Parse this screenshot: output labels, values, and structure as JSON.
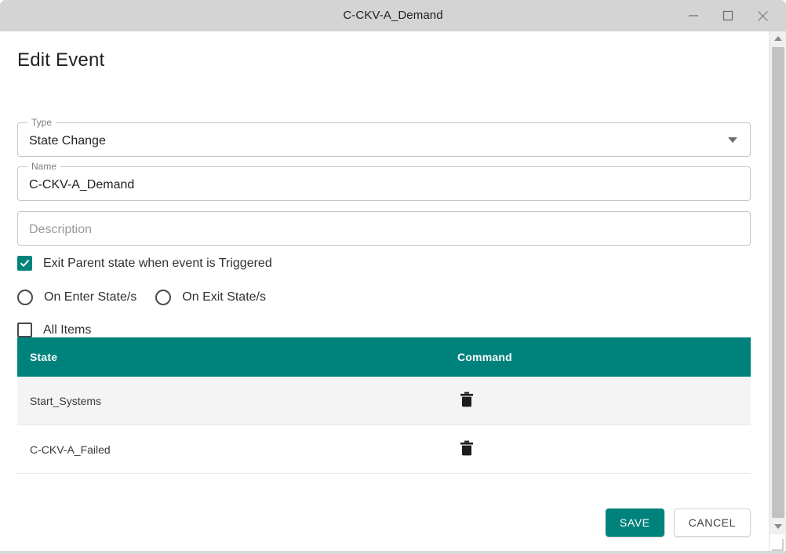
{
  "window": {
    "title": "C-CKV-A_Demand",
    "controls": {
      "minimize": "minimize-icon",
      "maximize": "maximize-icon",
      "close": "close-icon"
    }
  },
  "dialog": {
    "heading": "Edit Event",
    "fields": {
      "type": {
        "label": "Type",
        "value": "State Change",
        "icon": "chevron-down-icon"
      },
      "name": {
        "label": "Name",
        "value": "C-CKV-A_Demand"
      },
      "description": {
        "label": "",
        "value": "",
        "placeholder": "Description"
      }
    },
    "options": {
      "exit_parent": {
        "label": "Exit Parent state when event is Triggered",
        "checked": true
      },
      "on_enter": {
        "label": "On Enter State/s",
        "selected": false
      },
      "on_exit": {
        "label": "On Exit State/s",
        "selected": false
      },
      "all_items": {
        "label": "All Items",
        "checked": false
      }
    },
    "table": {
      "columns": [
        "State",
        "Command"
      ],
      "rows": [
        {
          "state": "Start_Systems",
          "command": "delete-icon"
        },
        {
          "state": "C-CKV-A_Failed",
          "command": "delete-icon"
        }
      ]
    },
    "buttons": {
      "save": "SAVE",
      "cancel": "CANCEL"
    }
  },
  "colors": {
    "accent": "#00827c",
    "titlebar": "#d4d4d4",
    "row_alt": "#f4f4f4",
    "text": "#212121"
  }
}
